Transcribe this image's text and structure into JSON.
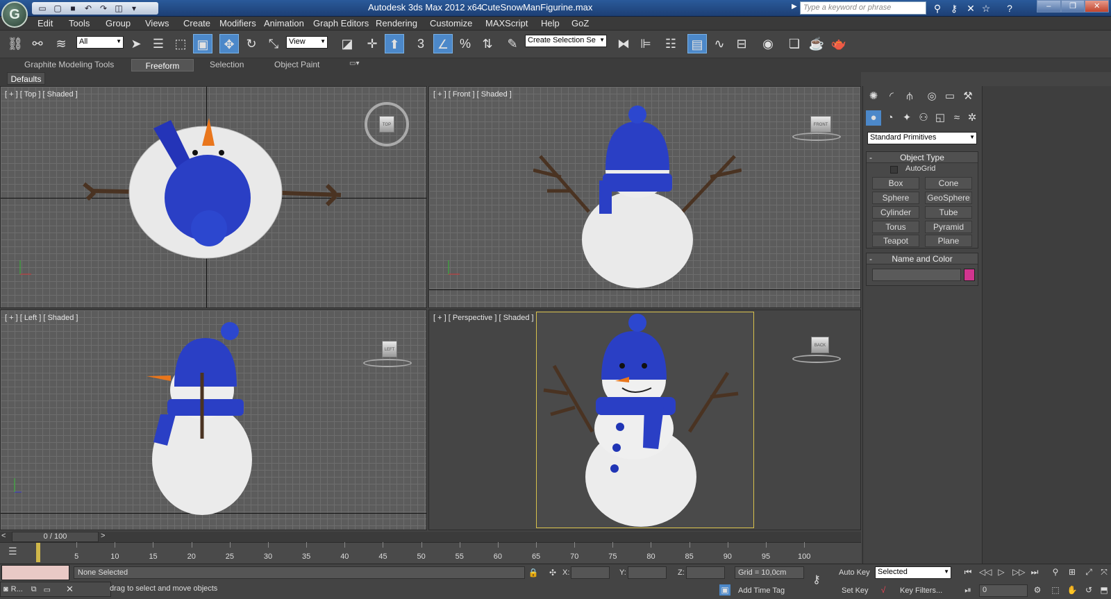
{
  "titlebar": {
    "app": "Autodesk 3ds Max  2012 x64",
    "document": "CuteSnowManFigurine.max",
    "search_placeholder": "Type a keyword or phrase"
  },
  "menu": [
    "Edit",
    "Tools",
    "Group",
    "Views",
    "Create",
    "Modifiers",
    "Animation",
    "Graph Editors",
    "Rendering",
    "Customize",
    "MAXScript",
    "Help",
    "GoZ"
  ],
  "toolbar": {
    "selection_filter": "All",
    "reference_coord": "View",
    "snap_label": "3",
    "named_selection": "Create Selection Se"
  },
  "ribbon": {
    "tabs": [
      "Graphite Modeling Tools",
      "Freeform",
      "Selection",
      "Object Paint"
    ],
    "active_tab": "Freeform",
    "panel": "Defaults"
  },
  "viewports": {
    "top": "[ + ] [ Top ] [ Shaded ]",
    "front": "[ + ] [ Front ] [ Shaded ]",
    "left": "[ + ] [ Left ] [ Shaded ]",
    "perspective": "[ + ] [ Perspective ] [ Shaded ]",
    "cube_top": "TOP",
    "cube_front": "FRONT",
    "cube_left": "LEFT",
    "cube_back": "BACK"
  },
  "command_panel": {
    "category": "Standard Primitives",
    "object_type_title": "Object Type",
    "autogrid": "AutoGrid",
    "buttons": [
      "Box",
      "Cone",
      "Sphere",
      "GeoSphere",
      "Cylinder",
      "Tube",
      "Torus",
      "Pyramid",
      "Teapot",
      "Plane"
    ],
    "name_color_title": "Name and Color",
    "color": "#d0358f"
  },
  "timeline": {
    "slider": "0 / 100",
    "ticks": [
      "5",
      "10",
      "15",
      "20",
      "25",
      "30",
      "35",
      "40",
      "45",
      "50",
      "55",
      "60",
      "65",
      "70",
      "75",
      "80",
      "85",
      "90",
      "95",
      "100"
    ]
  },
  "status": {
    "selection": "None Selected",
    "prompt": "Click or click-and-drag to select and move objects",
    "prompt_visible": "drag to select and move objects",
    "x_label": "X:",
    "y_label": "Y:",
    "z_label": "Z:",
    "grid": "Grid = 10,0cm",
    "add_time_tag": "Add Time Tag",
    "auto_key": "Auto Key",
    "set_key": "Set Key",
    "selected": "Selected",
    "key_filters": "Key Filters...",
    "frame": "0",
    "taskbar_label": "R..."
  }
}
